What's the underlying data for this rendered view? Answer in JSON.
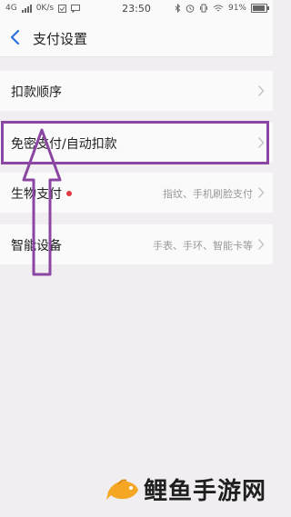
{
  "status_bar": {
    "network": "4G",
    "speed": "0K/s",
    "time": "23:50",
    "battery_percent": "91%",
    "battery_level": 0.91
  },
  "header": {
    "title": "支付设置"
  },
  "settings": {
    "items": [
      {
        "label": "扣款顺序",
        "value": ""
      },
      {
        "label": "免密支付/自动扣款",
        "value": ""
      },
      {
        "label": "生物支付",
        "value": "指纹、手机刷脸支付"
      },
      {
        "label": "智能设备",
        "value": "手表、手环、智能卡等"
      }
    ]
  },
  "annotation": {
    "highlight_color": "#8b46a3"
  },
  "colors": {
    "dot": "#e0383e",
    "watermark_logo": "#f5a623"
  },
  "watermark": {
    "text": "鲤鱼手游网"
  }
}
